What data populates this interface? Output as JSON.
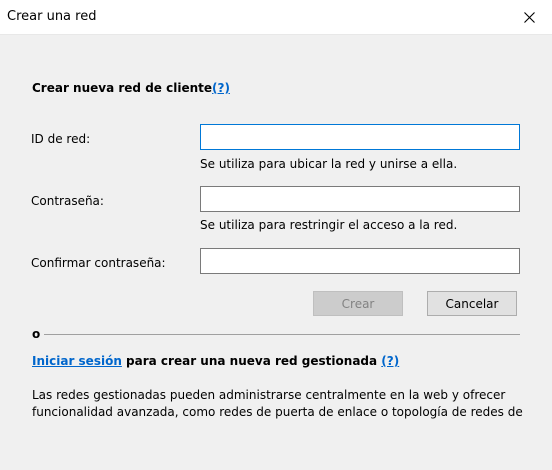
{
  "window": {
    "title": "Crear una red"
  },
  "form": {
    "heading": "Crear nueva red de cliente",
    "heading_help": "(?)",
    "network_id": {
      "label": "ID de red:",
      "value": "",
      "hint": "Se utiliza para ubicar la red y unirse a ella."
    },
    "password": {
      "label": "Contraseña:",
      "value": "",
      "hint": "Se utiliza para restringir el acceso a la red."
    },
    "confirm_password": {
      "label": "Confirmar contraseña:",
      "value": ""
    },
    "create_label": "Crear",
    "cancel_label": "Cancelar"
  },
  "separator": {
    "text": "o"
  },
  "managed": {
    "login_link": "Iniciar sesión",
    "text": " para crear una nueva red gestionada ",
    "help": "(?)",
    "description_line1": "Las redes gestionadas pueden administrarse centralmente en la web y ofrecer",
    "description_line2": "funcionalidad avanzada, como redes de puerta de enlace o topología de redes de"
  },
  "icons": {
    "close": "close-icon"
  },
  "colors": {
    "link": "#0066cc",
    "focus_border": "#0078d7",
    "dialog_bg": "#f0f0f0"
  }
}
